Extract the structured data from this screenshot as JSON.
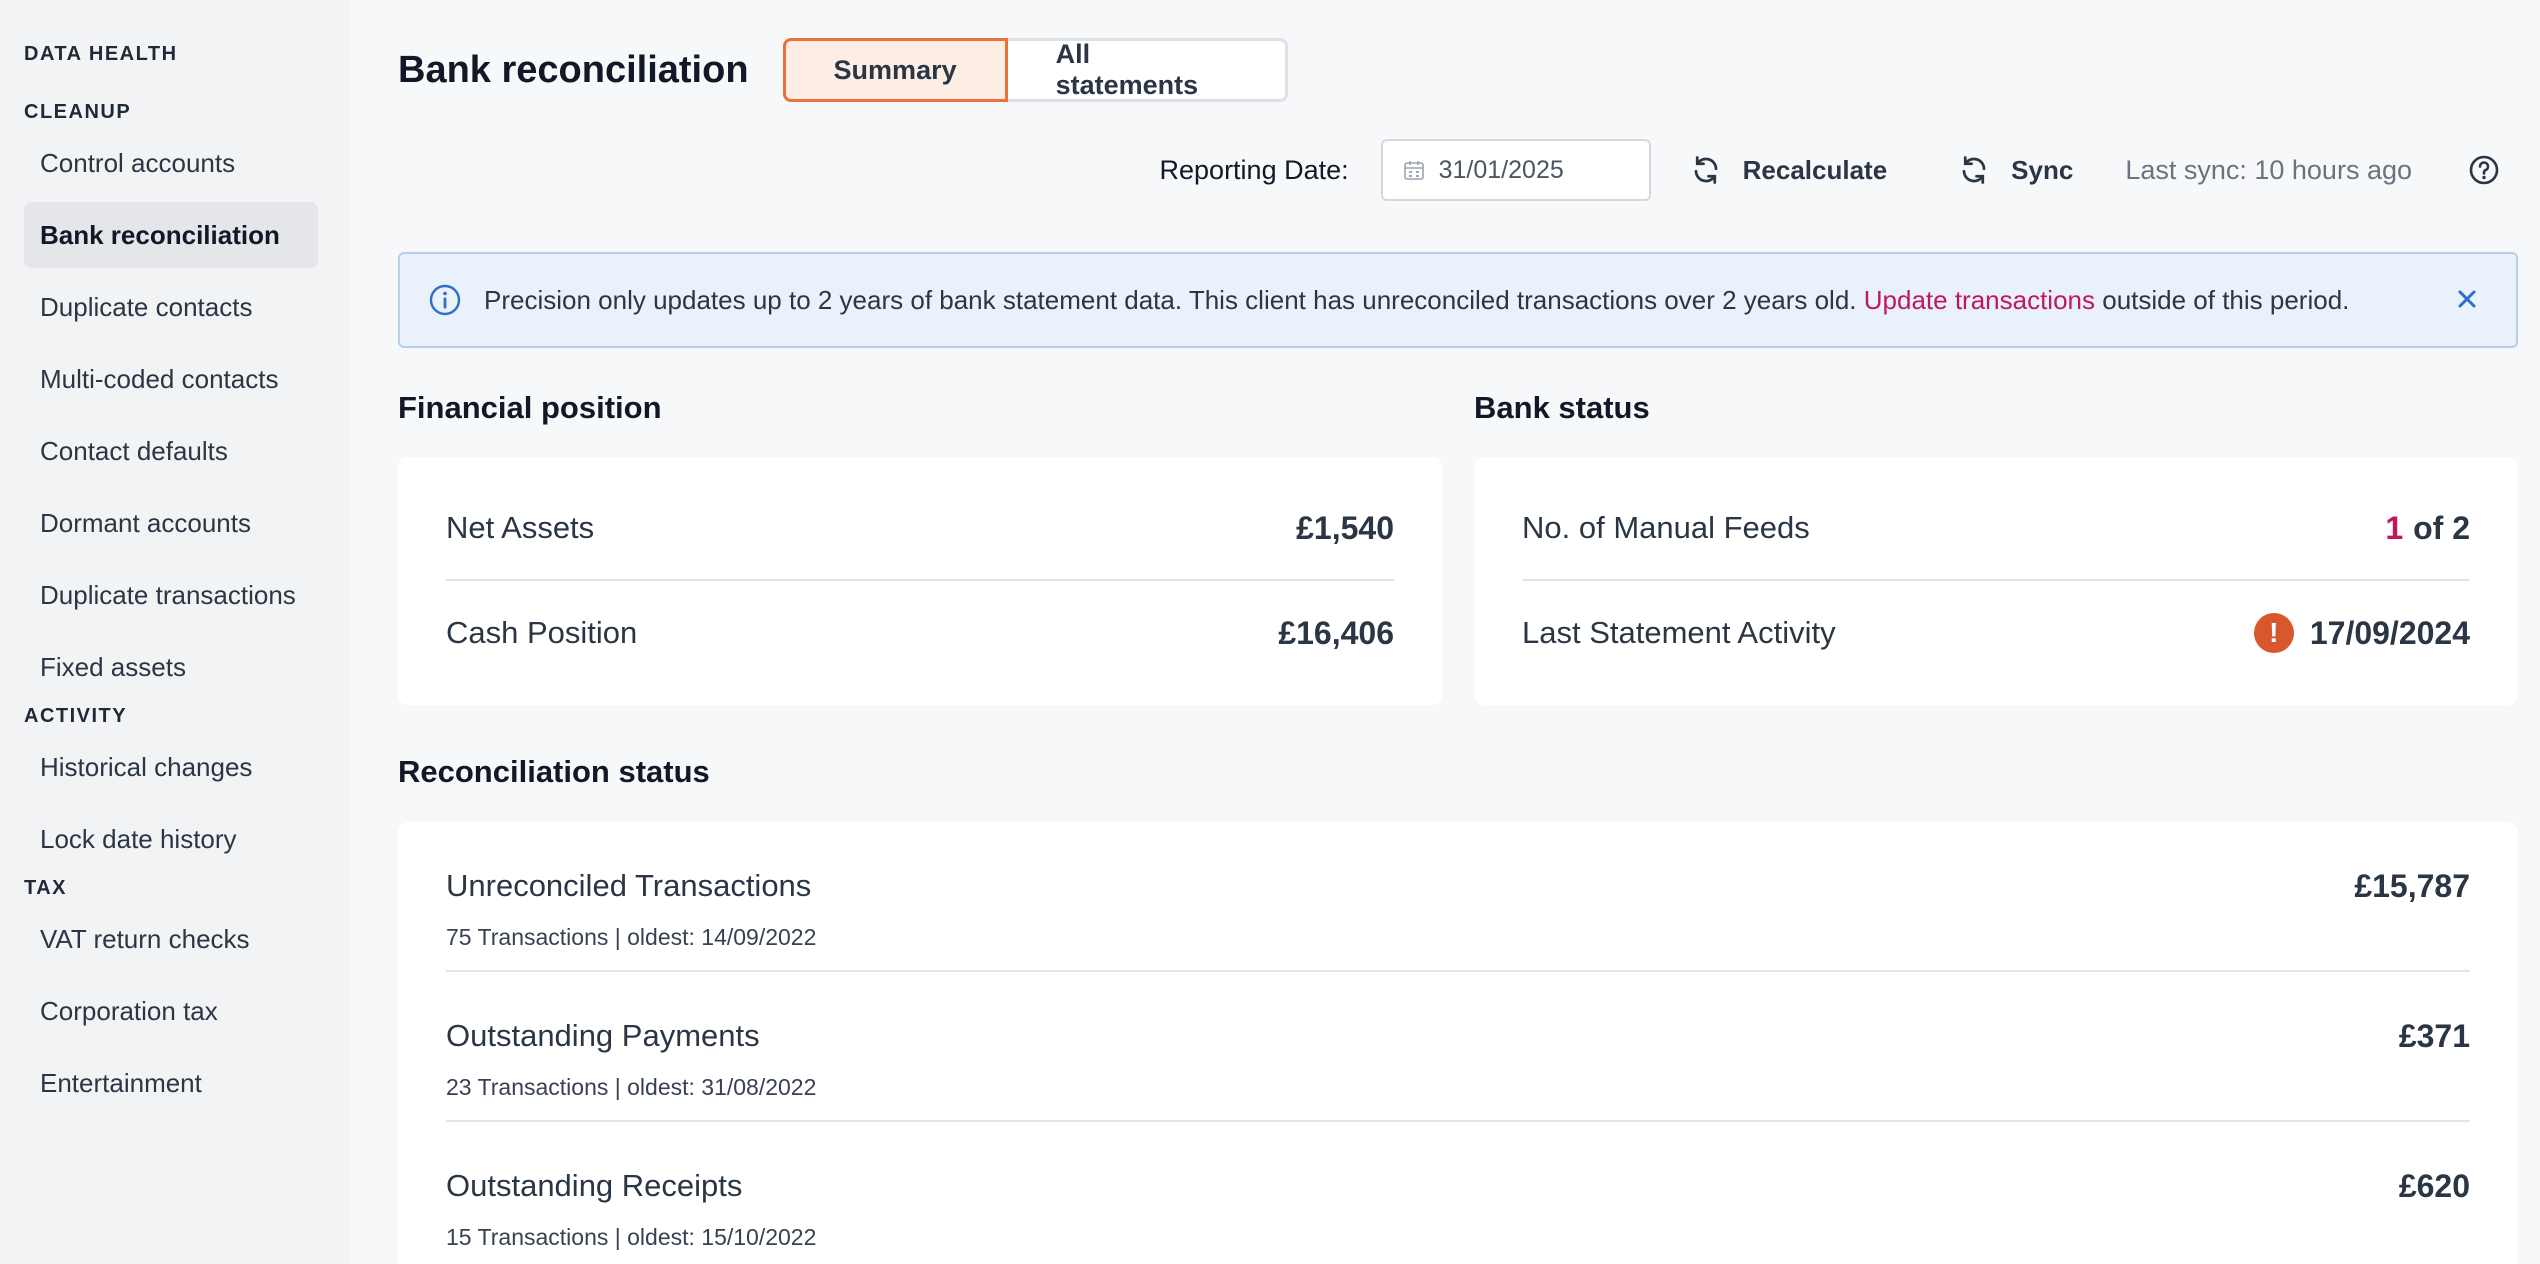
{
  "sidebar": {
    "sections": [
      {
        "label": "DATA HEALTH",
        "items": []
      },
      {
        "label": "CLEANUP",
        "items": [
          "Control accounts",
          "Bank reconciliation",
          "Duplicate contacts",
          "Multi-coded contacts",
          "Contact defaults",
          "Dormant accounts",
          "Duplicate transactions",
          "Fixed assets"
        ]
      },
      {
        "label": "ACTIVITY",
        "items": [
          "Historical changes",
          "Lock date history"
        ]
      },
      {
        "label": "TAX",
        "items": [
          "VAT return checks",
          "Corporation tax",
          "Entertainment"
        ]
      }
    ],
    "active_item": "Bank reconciliation"
  },
  "header": {
    "title": "Bank reconciliation",
    "tabs": [
      "Summary",
      "All statements"
    ],
    "selected_tab": "Summary"
  },
  "toolbar": {
    "reporting_label": "Reporting Date:",
    "reporting_date": "31/01/2025",
    "recalculate_label": "Recalculate",
    "sync_label": "Sync",
    "last_sync": "Last sync: 10 hours ago"
  },
  "banner": {
    "text_before": "Precision only updates up to 2 years of bank statement data. This client has unreconciled transactions over 2 years old.",
    "link_text": "Update transactions",
    "text_after": "outside of this period."
  },
  "financial_position": {
    "title": "Financial position",
    "rows": [
      {
        "label": "Net Assets",
        "value": "£1,540"
      },
      {
        "label": "Cash Position",
        "value": "£16,406"
      }
    ]
  },
  "bank_status": {
    "title": "Bank status",
    "manual_feeds_label": "No. of Manual Feeds",
    "manual_feeds_count": "1",
    "manual_feeds_total": "of 2",
    "last_activity_label": "Last Statement Activity",
    "last_activity_value": "17/09/2024"
  },
  "reconciliation": {
    "title": "Reconciliation status",
    "rows": [
      {
        "name": "Unreconciled Transactions",
        "meta": "75 Transactions | oldest: 14/09/2022",
        "amount": "£15,787"
      },
      {
        "name": "Outstanding Payments",
        "meta": "23 Transactions | oldest: 31/08/2022",
        "amount": "£371"
      },
      {
        "name": "Outstanding Receipts",
        "meta": "15 Transactions | oldest: 15/10/2022",
        "amount": "£620"
      }
    ]
  },
  "colors": {
    "accent": "#e8723a",
    "link": "#c2185b",
    "warning": "#d9572d",
    "info_bg": "#e9f1fb"
  }
}
